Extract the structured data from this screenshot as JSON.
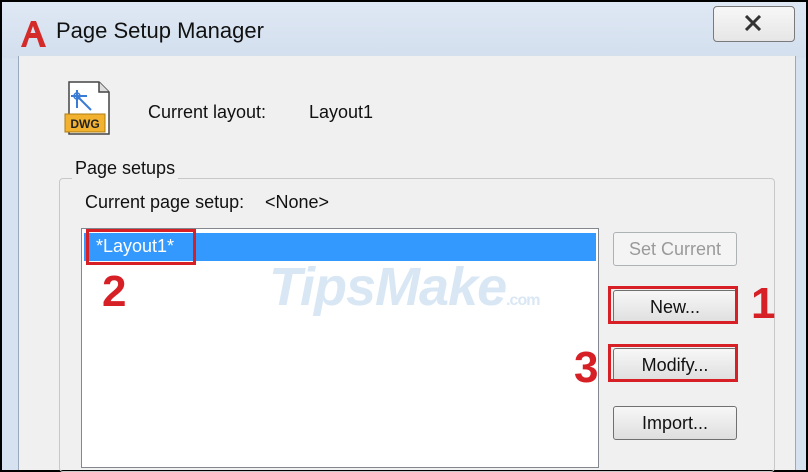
{
  "window": {
    "title": "Page Setup Manager"
  },
  "layout": {
    "label": "Current layout:",
    "value": "Layout1"
  },
  "group": {
    "legend": "Page setups"
  },
  "current_setup": {
    "label": "Current page setup:",
    "value": "<None>"
  },
  "list": {
    "items": [
      {
        "label": "*Layout1*",
        "selected": true
      }
    ]
  },
  "buttons": {
    "set_current": "Set Current",
    "new": "New...",
    "modify": "Modify...",
    "import": "Import..."
  },
  "annotations": {
    "n1": "1",
    "n2": "2",
    "n3": "3"
  },
  "watermark": {
    "text": "TipsMake",
    "suffix": ".com"
  },
  "icons": {
    "app": "autocad-logo-icon",
    "file": "dwg-file-icon",
    "close": "close-icon"
  },
  "colors": {
    "highlight": "#d62026",
    "selection": "#3399ff"
  }
}
